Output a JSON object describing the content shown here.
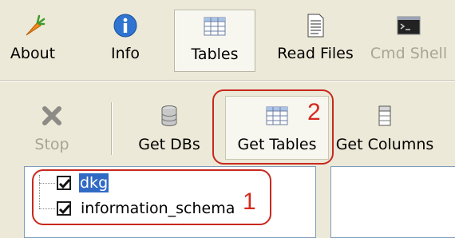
{
  "toolbar": {
    "about": "About",
    "info": "Info",
    "tables": "Tables",
    "read_files": "Read Files",
    "cmd_shell": "Cmd Shell"
  },
  "actions": {
    "stop": "Stop",
    "get_dbs": "Get DBs",
    "get_tables": "Get Tables",
    "get_columns": "Get Columns"
  },
  "databases": [
    {
      "name": "dkg",
      "checked": true,
      "selected": true
    },
    {
      "name": "information_schema",
      "checked": true,
      "selected": false
    }
  ],
  "annotations": {
    "first": "1",
    "second": "2"
  },
  "colors": {
    "accent_red": "#d42a1e",
    "selection": "#316ac5"
  }
}
